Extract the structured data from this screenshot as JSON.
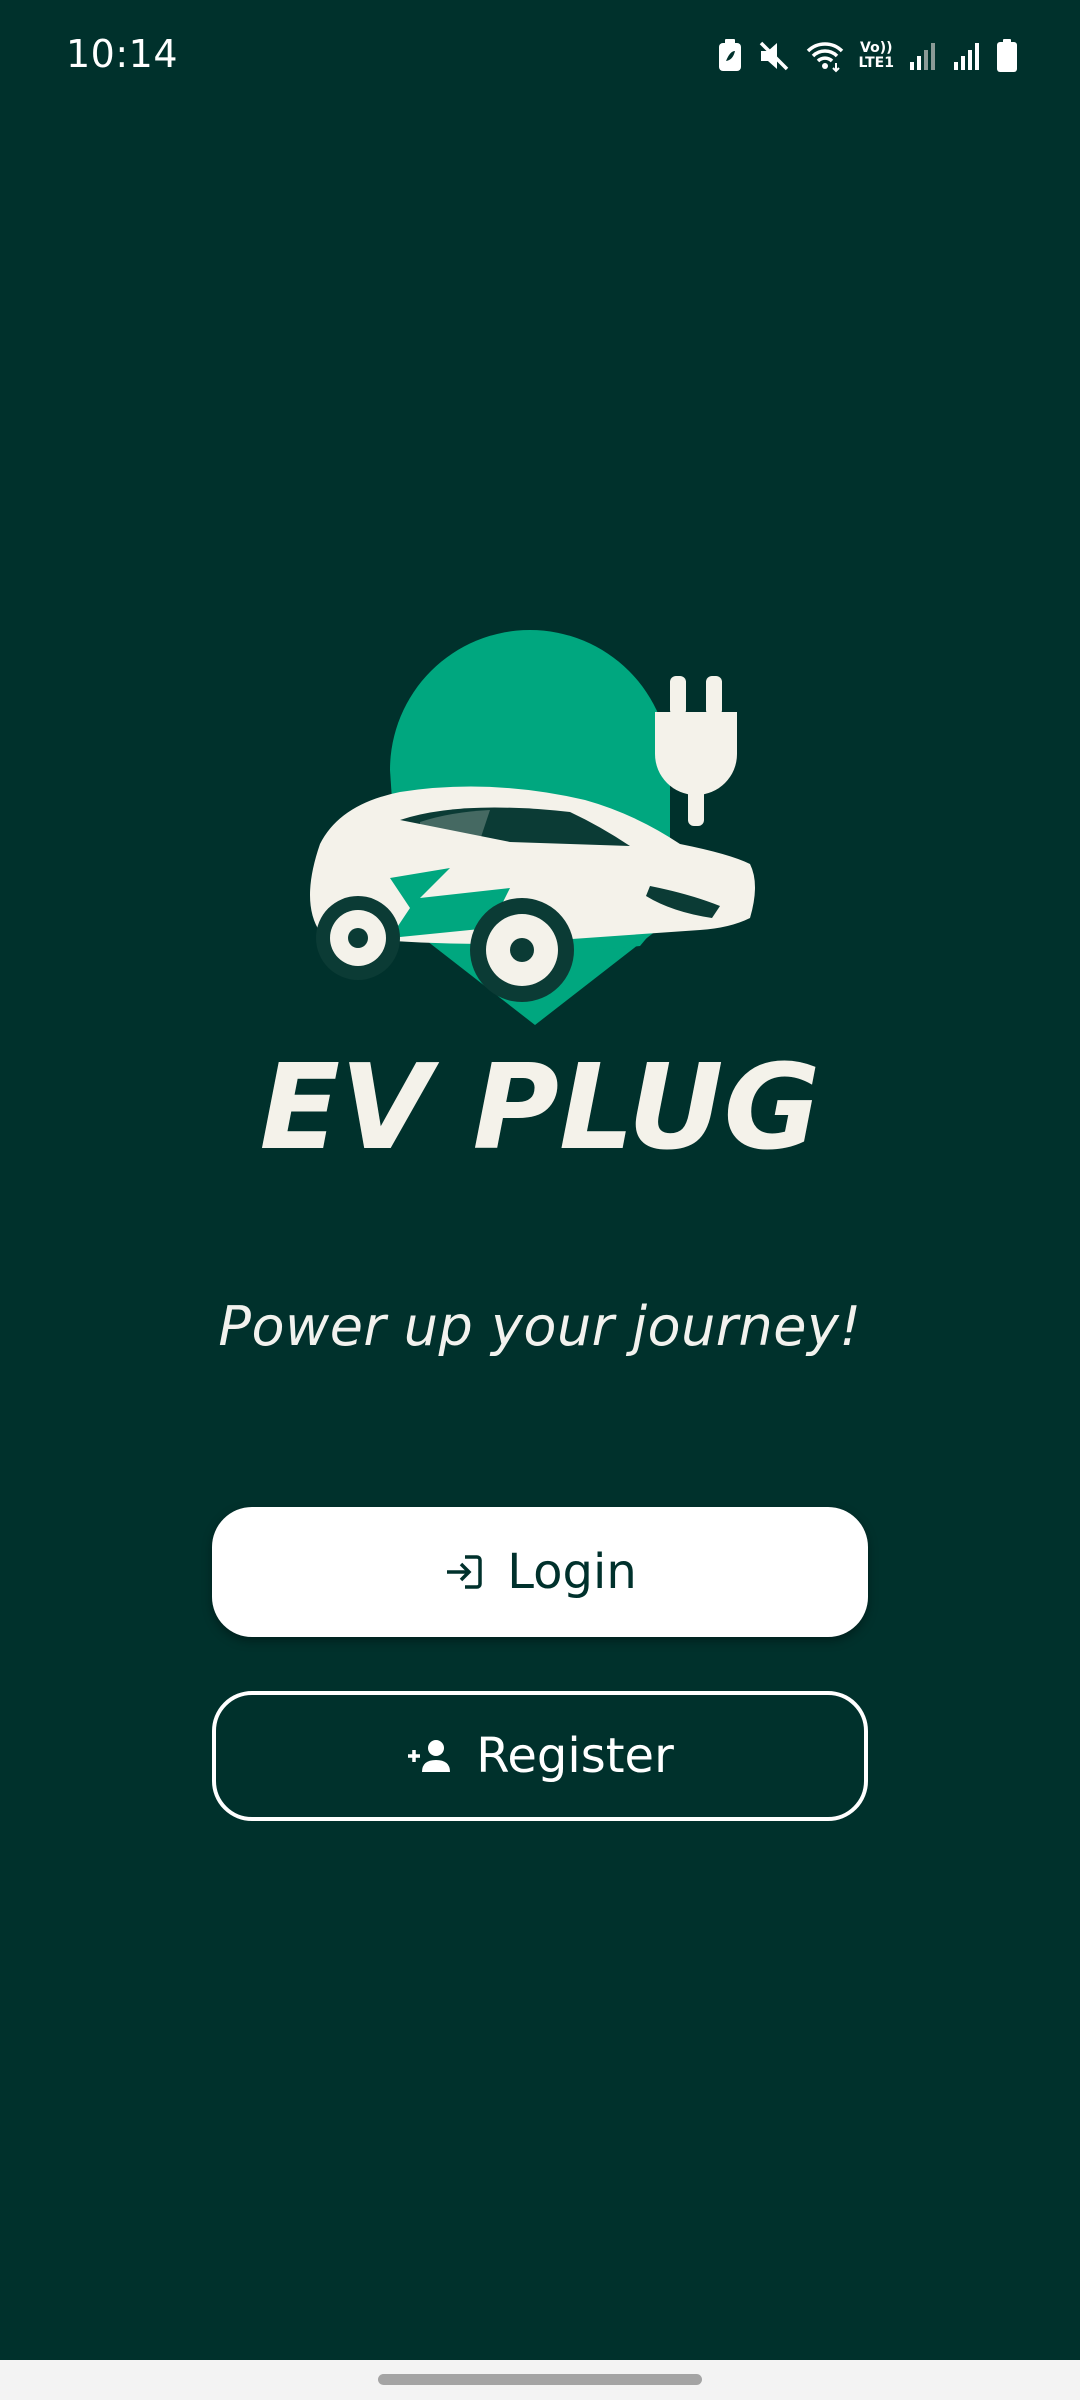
{
  "status_bar": {
    "time": "10:14",
    "volte_top": "Vo))",
    "volte_bottom": "LTE1",
    "icons": [
      "battery-saver-icon",
      "mute-icon",
      "wifi-icon",
      "volte-icon",
      "signal-sim1-icon",
      "signal-sim2-icon",
      "battery-icon"
    ]
  },
  "app": {
    "logo_text": "EV PLUG",
    "tagline": "Power up your journey!"
  },
  "buttons": {
    "login_label": "Login",
    "login_icon": "login-icon",
    "register_label": "Register",
    "register_icon": "add-person-icon"
  },
  "colors": {
    "background": "#00312c",
    "accent_green": "#00a77f",
    "logo_cream": "#f4f2ea",
    "button_white": "#ffffff"
  }
}
